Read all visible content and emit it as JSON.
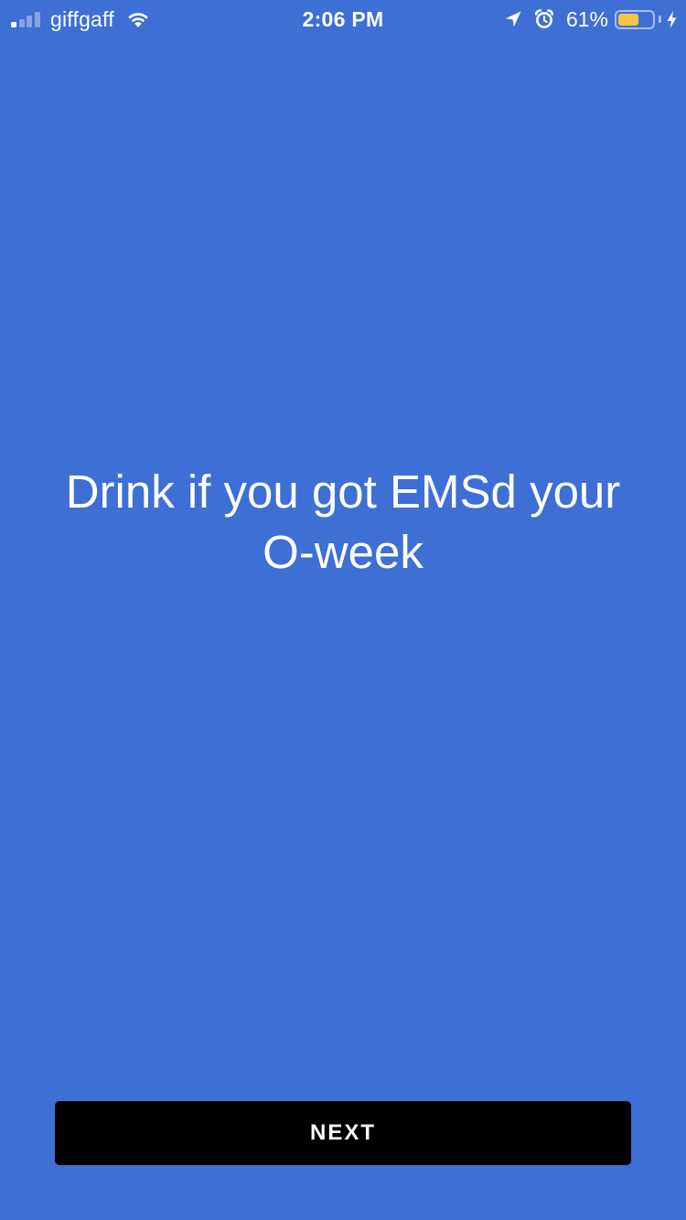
{
  "status_bar": {
    "carrier": "giffgaff",
    "time": "2:06 PM",
    "battery_percent_label": "61%",
    "battery_level": 0.61,
    "signal_strength_bars": 1,
    "icons": [
      "signal-icon",
      "wifi-icon",
      "location-arrow-icon",
      "alarm-icon",
      "battery-icon",
      "charging-bolt-icon"
    ]
  },
  "card": {
    "prompt": "Drink if you got EMSd your O-week"
  },
  "actions": {
    "next_label": "NEXT"
  },
  "colors": {
    "background": "#3d6fd4",
    "button": "#000000",
    "text": "#ffffff",
    "battery_fill": "#f7c443"
  }
}
